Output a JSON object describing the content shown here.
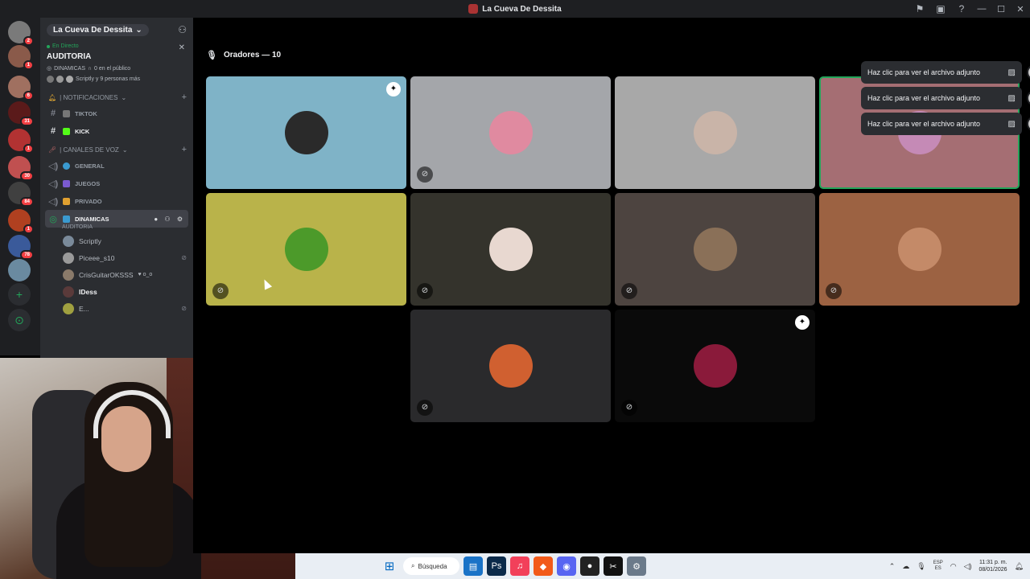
{
  "window": {
    "title": "La Cueva De Dessita",
    "controls": [
      "inbox-icon",
      "help-icon",
      "minimize",
      "maximize",
      "close"
    ]
  },
  "servers": [
    {
      "badge": "2",
      "color": "#7a7a7a"
    },
    {
      "badge": "1",
      "color": "#8a5a4a"
    },
    {
      "badge": "6",
      "color": "#a07060"
    },
    {
      "badge": "31",
      "color": "#5a1a1a"
    },
    {
      "badge": "1",
      "color": "#b23232"
    },
    {
      "badge": "30",
      "color": "#c05050"
    },
    {
      "badge": "84",
      "color": "#404040"
    },
    {
      "badge": "1",
      "color": "#b04020"
    },
    {
      "badge": "78",
      "color": "#3a5a9a"
    },
    {
      "badge": "",
      "color": "#6a8aa0"
    }
  ],
  "sidebar": {
    "server_name": "La Cueva De Dessita",
    "live": {
      "tag": "En Directo",
      "title": "AUDITORIA",
      "channel": "DINAMICAS",
      "audience": "0 en el público",
      "listeners": "Scriptly y 9 personas más"
    },
    "categories": [
      {
        "label": "| NOTIFICACIONES"
      },
      {
        "label": "| CANALES DE VOZ"
      }
    ],
    "text_channels": [
      {
        "name": "TIKTOK",
        "active": false
      },
      {
        "name": "KICK",
        "active": true
      }
    ],
    "voice_channels": [
      {
        "name": "GENERAL"
      },
      {
        "name": "JUEGOS"
      },
      {
        "name": "PRIVADO"
      }
    ],
    "selected_channel": {
      "name": "DINAMICAS",
      "sub": "AUDITORIA"
    },
    "users": [
      {
        "name": "Scriptly",
        "bold": false
      },
      {
        "name": "Piceee_s10",
        "bold": false
      },
      {
        "name": "CrisGuitarOKSSS",
        "bold": false
      },
      {
        "name": "IDess",
        "bold": true
      },
      {
        "name": "E...",
        "bold": false
      }
    ]
  },
  "stage": {
    "speakers_label": "Oradores — 10"
  },
  "tiles": [
    {
      "bg": "#7fb3c7",
      "avatar": "#2a2a2a",
      "mute": false,
      "badge": true,
      "speaking": false
    },
    {
      "bg": "#a4a6aa",
      "avatar": "#e08aa0",
      "mute": true,
      "badge": false,
      "speaking": false
    },
    {
      "bg": "#a8a8a8",
      "avatar": "#c9b4a8",
      "mute": false,
      "badge": false,
      "speaking": false
    },
    {
      "bg": "#a56e73",
      "avatar": "#c58ab6",
      "mute": false,
      "badge": false,
      "speaking": true
    },
    {
      "bg": "#b9b34a",
      "avatar": "#4c9a2a",
      "mute": true,
      "badge": false,
      "speaking": false
    },
    {
      "bg": "#34332c",
      "avatar": "#e8d8d0",
      "mute": true,
      "badge": false,
      "speaking": false
    },
    {
      "bg": "#4d4440",
      "avatar": "#8a7058",
      "mute": true,
      "badge": false,
      "speaking": false
    },
    {
      "bg": "#9c6242",
      "avatar": "#c48a68",
      "mute": true,
      "badge": false,
      "speaking": false
    },
    {
      "bg": "#2a2a2c",
      "avatar": "#d06030",
      "mute": true,
      "badge": false,
      "speaking": false
    },
    {
      "bg": "#0a0a0a",
      "avatar": "#8a1a3a",
      "mute": true,
      "badge": true,
      "speaking": false
    }
  ],
  "toasts": [
    {
      "text": "Haz clic para ver el archivo adjunto"
    },
    {
      "text": "Haz clic para ver el archivo adjunto"
    },
    {
      "text": "Haz clic para ver el archivo adjunto"
    }
  ],
  "taskbar": {
    "search_placeholder": "Búsqueda",
    "apps": [
      {
        "name": "windows-start-icon",
        "color": "#0067c0"
      },
      {
        "name": "explorer-icon",
        "color": "#1a73c7"
      },
      {
        "name": "photoshop-icon",
        "color": "#0b2a4a"
      },
      {
        "name": "music-icon",
        "color": "#f2405a"
      },
      {
        "name": "brave-icon",
        "color": "#f25a1a"
      },
      {
        "name": "discord-icon",
        "color": "#5865f2"
      },
      {
        "name": "obs-icon",
        "color": "#222"
      },
      {
        "name": "capcut-icon",
        "color": "#111"
      },
      {
        "name": "settings-icon",
        "color": "#6b7a8a"
      }
    ],
    "lang_top": "ESP",
    "lang_bottom": "ES",
    "time": "11:31 p. m.",
    "date": "08/01/2026"
  }
}
